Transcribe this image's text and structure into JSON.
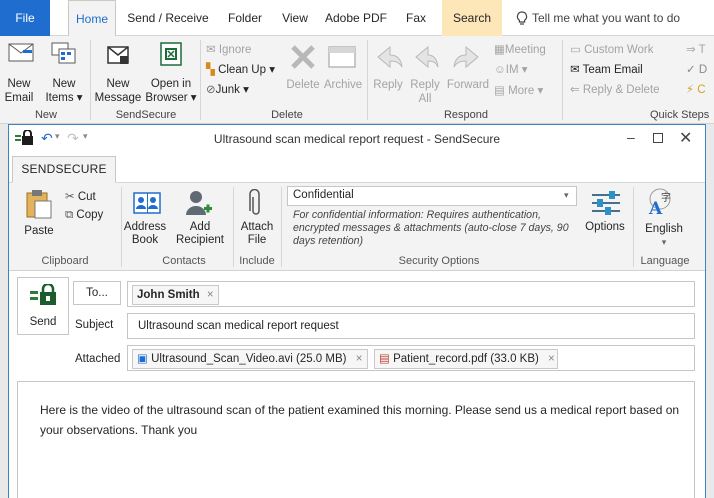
{
  "outer_tabs": {
    "file": "File",
    "home": "Home",
    "send_receive": "Send / Receive",
    "folder": "Folder",
    "view": "View",
    "adobe_pdf": "Adobe PDF",
    "fax": "Fax",
    "search": "Search",
    "tell_me": "Tell me what you want to do"
  },
  "outer_ribbon": {
    "new_email": [
      "New",
      "Email"
    ],
    "new_items": [
      "New",
      "Items"
    ],
    "new_message": [
      "New",
      "Message"
    ],
    "open_in_browser": [
      "Open in",
      "Browser"
    ],
    "ignore": "Ignore",
    "clean_up": "Clean Up",
    "junk": "Junk",
    "delete": "Delete",
    "archive": "Archive",
    "reply": "Reply",
    "reply_all": [
      "Reply",
      "All"
    ],
    "forward": "Forward",
    "meeting": "Meeting",
    "im": "IM",
    "more": "More",
    "qs_custom_work": "Custom Work",
    "qs_team_email": "Team Email",
    "qs_reply_delete": "Reply & Delete",
    "groups": {
      "new": "New",
      "sendsecure": "SendSecure",
      "delete": "Delete",
      "respond": "Respond",
      "quick_steps": "Quick Steps"
    }
  },
  "window": {
    "title": "Ultrasound scan medical report request - SendSecure",
    "tab": "SENDSECURE"
  },
  "inner_ribbon": {
    "paste": "Paste",
    "cut": "Cut",
    "copy": "Copy",
    "address_book": [
      "Address",
      "Book"
    ],
    "add_recipient": [
      "Add",
      "Recipient"
    ],
    "attach_file": [
      "Attach",
      "File"
    ],
    "security_level": "Confidential",
    "security_desc": "For confidential information: Requires authentication, encrypted messages & attachments (auto-close 7 days, 90 days retention)",
    "options": "Options",
    "language": "English",
    "groups": {
      "clipboard": "Clipboard",
      "contacts": "Contacts",
      "include": "Include",
      "security": "Security Options",
      "language": "Language"
    }
  },
  "compose": {
    "send": "Send",
    "to_label": "To...",
    "to_recipient": "John Smith",
    "subject_label": "Subject",
    "subject": "Ultrasound scan medical report request",
    "attached_label": "Attached",
    "attachments": [
      {
        "name": "Ultrasound_Scan_Video.avi (25.0 MB)"
      },
      {
        "name": "Patient_record.pdf (33.0 KB)"
      }
    ],
    "body": "Here is the video of the ultrasound scan of the patient examined this morning.  Please send us a medical report based on your observations.  Thank you"
  },
  "colors": {
    "accent": "#1f6ecf",
    "search_tab": "#fde6b8",
    "send_icon": "#2e7d3b"
  }
}
